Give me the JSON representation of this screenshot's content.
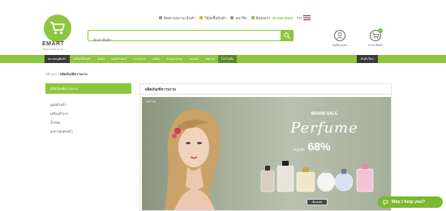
{
  "logo": {
    "text": "EMART",
    "tagline": "www.emart.co.th"
  },
  "toplinks": {
    "order_status": "ติดตามสถานะสินค้า",
    "how_to_order": "วิธีสั่งซื้อสินค้า",
    "member": "สมาชิก",
    "call_center": "ติดต่อเรา",
    "phone": "02-266-8000",
    "lang": "TH"
  },
  "search": {
    "placeholder": "ค้นหาสินค้า..."
  },
  "header_icons": {
    "account": "บัญชีของฉัน",
    "cart": "ตะกร้าสินค้า"
  },
  "nav": {
    "items": [
      "หมวดหมู่สินค้า",
      "เครื่องใช้ไฟฟ้า",
      "มือถือ",
      "คอมพิวเตอร์",
      "ความงาม",
      "แฟชั่น",
      "บ้านและสวน",
      "ของเล่น",
      "สุขภาพ",
      "โปรโมชั่น"
    ],
    "right": "สินค้าใหม่"
  },
  "breadcrumb": {
    "home": "หน้าแรก",
    "separator": "/",
    "current": "ผลิตภัณฑ์ความงาม"
  },
  "sidebar": {
    "heading": "ผลิตภัณฑ์ความงาม",
    "items": [
      "ดูแลผิวหน้า",
      "เครื่องสำอาง",
      "น้ำหอม",
      "อุปกรณ์แต่งหน้า"
    ]
  },
  "main": {
    "title": "ผลิตภัณฑ์ความงาม",
    "banner": {
      "date": "SEP 30",
      "headline": "BRAND SALE",
      "title": "Perfume",
      "discount_prefix": "ลดสูงสุด",
      "discount": "68%",
      "cta": "ช้อปเลย"
    }
  },
  "chat": {
    "label": "May I help you?"
  },
  "colors": {
    "accent": "#8dc63f",
    "nav_dark": "#3b3b3b"
  }
}
